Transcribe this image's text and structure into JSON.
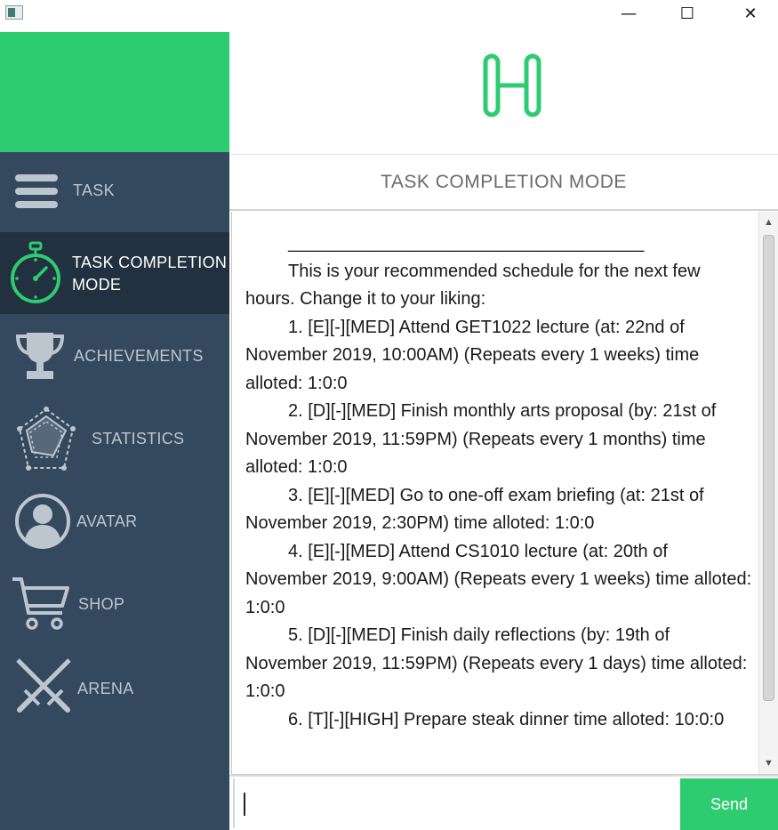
{
  "window": {
    "controls": {
      "minimize": "—",
      "maximize": "☐",
      "close": "✕"
    }
  },
  "colors": {
    "accent": "#2ecc71",
    "sidebar": "#34495e",
    "sidebar_active": "#223140",
    "sidebar_text": "#bcc6cf"
  },
  "sidebar": {
    "items": [
      {
        "label": "TASK",
        "icon": "hamburger-menu-icon"
      },
      {
        "label": "TASK COMPLETION\nMODE",
        "icon": "stopwatch-icon",
        "active": true
      },
      {
        "label": "ACHIEVEMENTS",
        "icon": "trophy-icon"
      },
      {
        "label": "STATISTICS",
        "icon": "radar-chart-icon"
      },
      {
        "label": "AVATAR",
        "icon": "user-avatar-icon"
      },
      {
        "label": "SHOP",
        "icon": "shopping-cart-icon"
      },
      {
        "label": "ARENA",
        "icon": "crossed-swords-icon"
      }
    ]
  },
  "header": {
    "logo_icon": "h-logo-icon",
    "mode_title": "TASK COMPLETION MODE"
  },
  "output": {
    "separator": "____________________________________",
    "intro": "This is your recommended schedule for the next few hours. Change it to your liking:",
    "tasks": [
      "1. [E][-][MED] Attend GET1022 lecture (at: 22nd of November 2019, 10:00AM) (Repeats every 1 weeks) time alloted: 1:0:0",
      "2. [D][-][MED] Finish monthly arts proposal (by: 21st of November 2019, 11:59PM) (Repeats every 1 months) time alloted: 1:0:0",
      "3. [E][-][MED] Go to one-off exam briefing (at: 21st of November 2019, 2:30PM) time alloted: 1:0:0",
      "4. [E][-][MED] Attend CS1010 lecture (at: 20th of November 2019, 9:00AM) (Repeats every 1 weeks) time alloted: 1:0:0",
      "5. [D][-][MED] Finish daily reflections (by: 19th of November 2019, 11:59PM) (Repeats every 1 days) time alloted: 1:0:0",
      "6. [T][-][HIGH] Prepare steak dinner time alloted: 10:0:0"
    ]
  },
  "input": {
    "value": "",
    "send_label": "Send"
  }
}
